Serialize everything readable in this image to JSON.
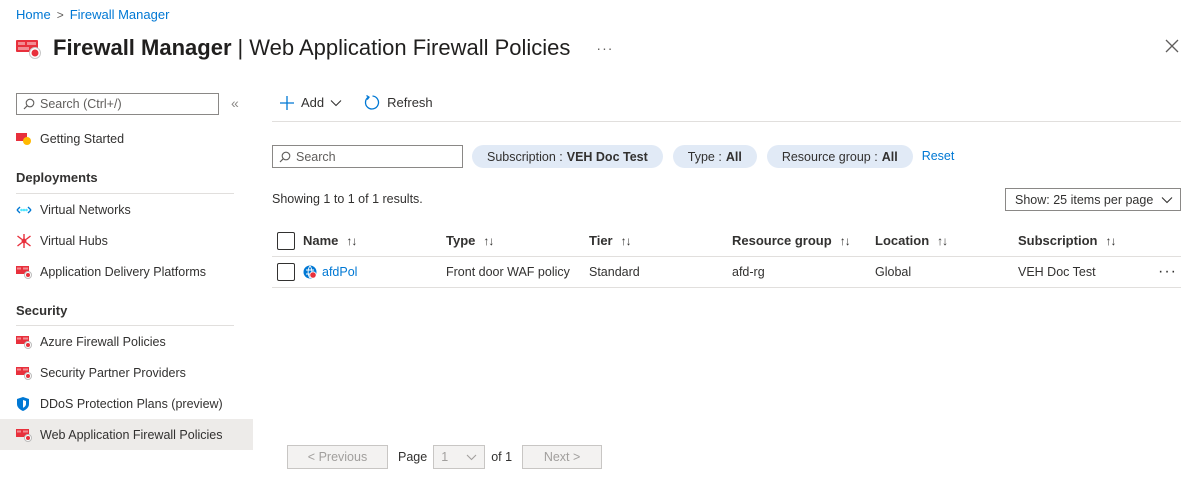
{
  "breadcrumb": {
    "home": "Home",
    "separator": ">",
    "current": "Firewall Manager"
  },
  "header": {
    "title_bold": "Firewall Manager",
    "title_sep": "|",
    "title_rest": "Web Application Firewall Policies",
    "more": "···"
  },
  "sidebar": {
    "search_placeholder": "Search (Ctrl+/)",
    "collapse": "«",
    "getting_started": "Getting Started",
    "deployments_header": "Deployments",
    "deployments": [
      {
        "label": "Virtual Networks",
        "icon": "virtual-network-icon"
      },
      {
        "label": "Virtual Hubs",
        "icon": "virtual-hub-icon"
      },
      {
        "label": "Application Delivery Platforms",
        "icon": "firewall-icon"
      }
    ],
    "security_header": "Security",
    "security": [
      {
        "label": "Azure Firewall Policies",
        "icon": "firewall-icon"
      },
      {
        "label": "Security Partner Providers",
        "icon": "firewall-icon"
      },
      {
        "label": "DDoS Protection Plans (preview)",
        "icon": "shield-icon"
      },
      {
        "label": "Web Application Firewall Policies",
        "icon": "firewall-icon",
        "active": true
      }
    ]
  },
  "toolbar": {
    "add_label": "Add",
    "refresh_label": "Refresh"
  },
  "filters": {
    "search_placeholder": "Search",
    "subscription_label": "Subscription :",
    "subscription_value": "VEH Doc Test",
    "type_label": "Type :",
    "type_value": "All",
    "rg_label": "Resource group :",
    "rg_value": "All",
    "reset_label": "Reset"
  },
  "results_text": "Showing 1 to 1 of 1 results.",
  "page_size_label": "Show: 25 items per page",
  "table": {
    "columns": [
      "Name",
      "Type",
      "Tier",
      "Resource group",
      "Location",
      "Subscription"
    ],
    "sort_icon": "↑↓",
    "rows": [
      {
        "name": "afdPol",
        "type": "Front door WAF policy",
        "tier": "Standard",
        "resource_group": "afd-rg",
        "location": "Global",
        "subscription": "VEH Doc Test",
        "more": "···"
      }
    ]
  },
  "pager": {
    "previous": "< Previous",
    "page_label": "Page",
    "current_page": "1",
    "of_label": "of 1",
    "next": "Next >"
  },
  "colors": {
    "accent": "#0078d4",
    "firewall_red": "#e8303c",
    "pill_bg": "#e1eaf6"
  }
}
